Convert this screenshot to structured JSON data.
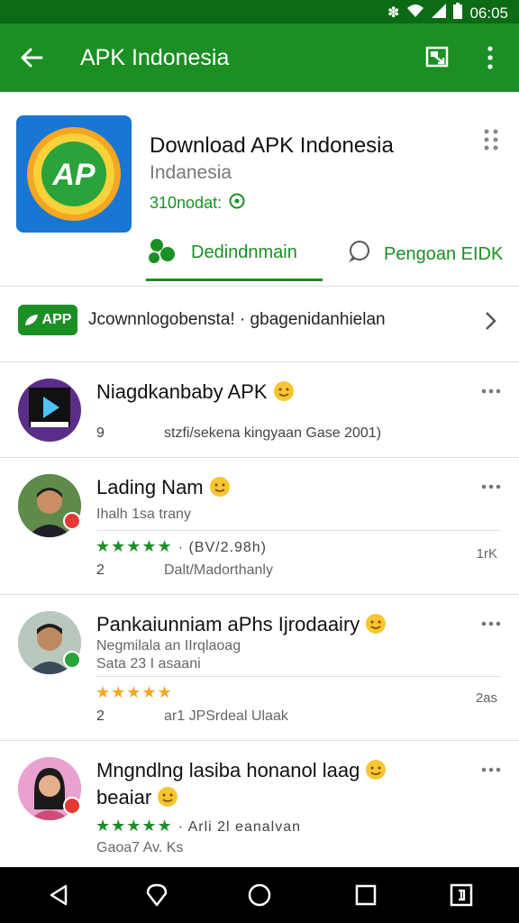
{
  "status": {
    "time": "06:05"
  },
  "appbar": {
    "title": "APK Indonesia"
  },
  "app": {
    "name": "Download APK Indonesia",
    "subtitle": "Indanesia",
    "meta": "310nodat:",
    "icon_letters": "AP",
    "tabs": [
      {
        "label": "Dedindnmain",
        "icon": "people-icon"
      },
      {
        "label": "Pengoan EIDK",
        "icon": "chat-bubble-icon"
      }
    ]
  },
  "promo": {
    "badge": "APP",
    "text": "Jcownnlogobensta! · ɡbagenidanhielan"
  },
  "items": [
    {
      "title": "Niagdkanbaby APK",
      "count": "9",
      "detail": "stzfi/sekena kingyaan Gase 2001)"
    },
    {
      "title": "Lading Nam",
      "sub": "Ihalh 1sa trany",
      "stars_suffix": "· (BV/2.98h)",
      "count": "2",
      "detail": "Dalt/Madorthanly",
      "right": "1rK"
    },
    {
      "title": "Pankaiunniam aPhs Ijrodaairy",
      "sub": "Negmilala an IIrqlaoag",
      "sub2": "Sata 23 I asaani",
      "count": "2",
      "detail": "ar1 JPSrdeal Ulaak",
      "right": "2as"
    },
    {
      "title": "Mngndlng lasiba honanol laag",
      "title2": "beaiar",
      "stars_suffix": "· Arli 2l eanalvan",
      "sub": "Gaoa7 Av. Ks"
    }
  ],
  "colors": {
    "primary": "#1b8f24",
    "status_bar": "#0b6b14",
    "star_green": "#1b8f24",
    "star_orange": "#f5a623"
  }
}
